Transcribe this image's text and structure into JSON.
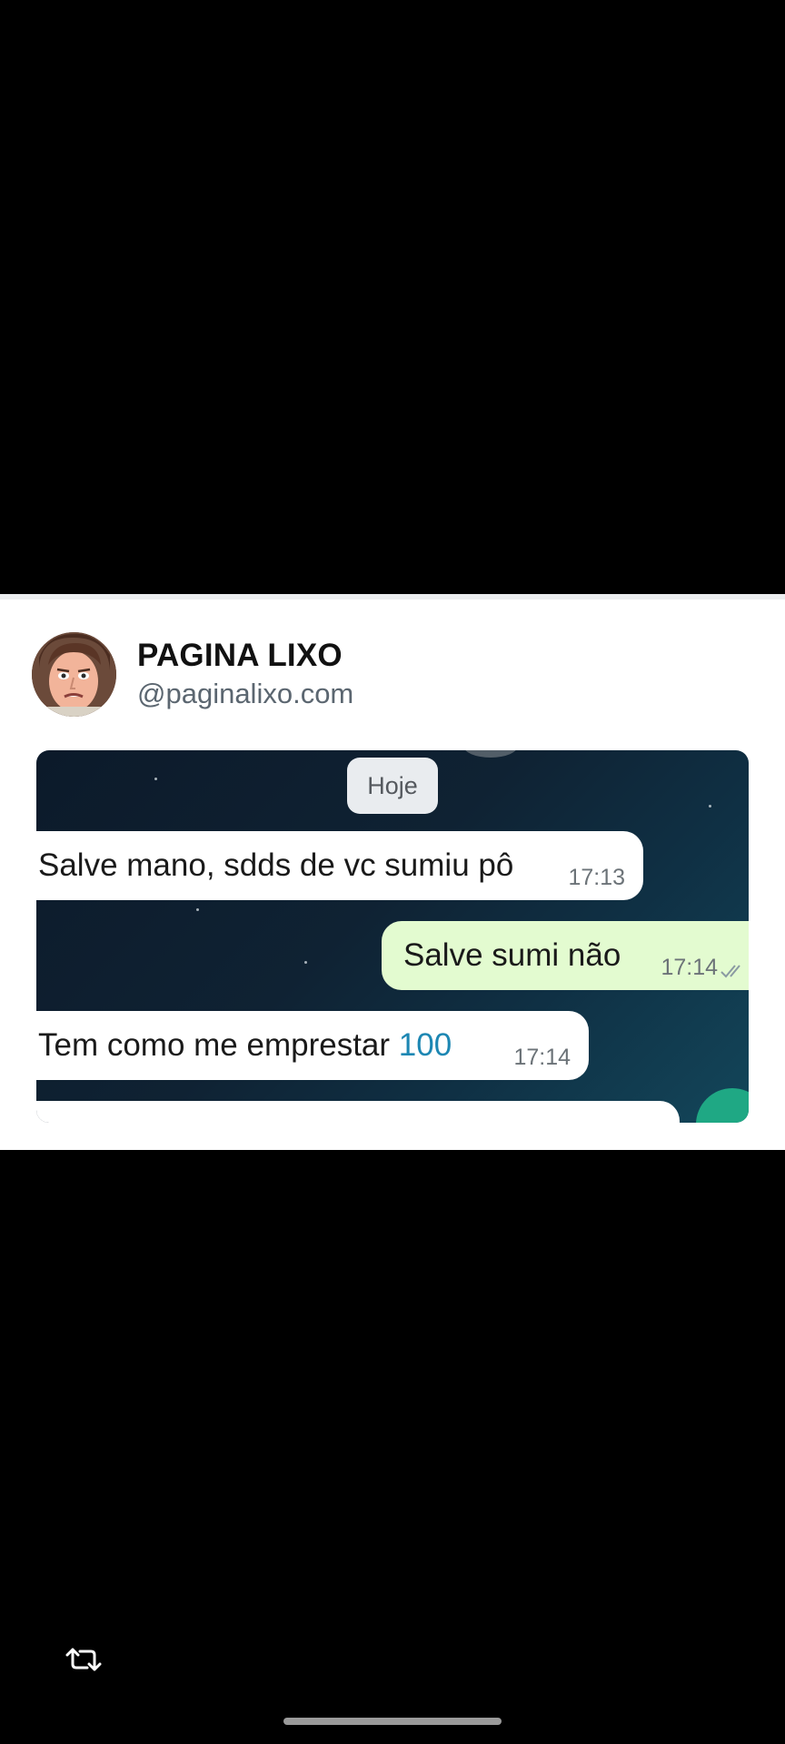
{
  "post": {
    "author_name": "PAGINA LIXO",
    "author_handle": "@paginalixo.com"
  },
  "chat": {
    "date_label": "Hoje",
    "messages": [
      {
        "text": "Salve mano, sdds de vc sumiu pô",
        "time": "17:13",
        "direction": "incoming"
      },
      {
        "text": "Salve sumi não",
        "time": "17:14",
        "direction": "outgoing",
        "read_receipt": "double-check-icon"
      },
      {
        "text_prefix": "Tem como me emprestar ",
        "text_number": "100",
        "time": "17:14",
        "direction": "incoming"
      }
    ]
  },
  "colors": {
    "background": "#000000",
    "card": "#ffffff",
    "outgoing_bubble": "#e3fbd0",
    "incoming_bubble": "#ffffff",
    "link_number": "#1d87b3",
    "chat_bg": "#0f2233"
  },
  "icons": {
    "retweet": "retweet-icon"
  }
}
